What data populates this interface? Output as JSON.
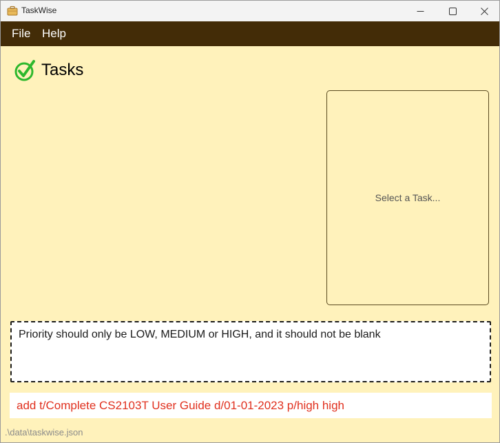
{
  "window": {
    "title": "TaskWise",
    "icon": "app-briefcase-icon"
  },
  "menu": {
    "file_label": "File",
    "help_label": "Help"
  },
  "header": {
    "title": "Tasks",
    "icon": "check-circle-icon"
  },
  "detail": {
    "placeholder": "Select a Task..."
  },
  "result": {
    "message": "Priority should only be LOW, MEDIUM or HIGH, and it should not be blank"
  },
  "command": {
    "value": "add t/Complete CS2103T User Guide d/01-01-2023 p/high high"
  },
  "status": {
    "file_path": ".\\data\\taskwise.json"
  },
  "colors": {
    "menu_bar": "#432c07",
    "background": "#fff2bb",
    "accent_green": "#2db82d",
    "error_text": "#e0301e"
  }
}
